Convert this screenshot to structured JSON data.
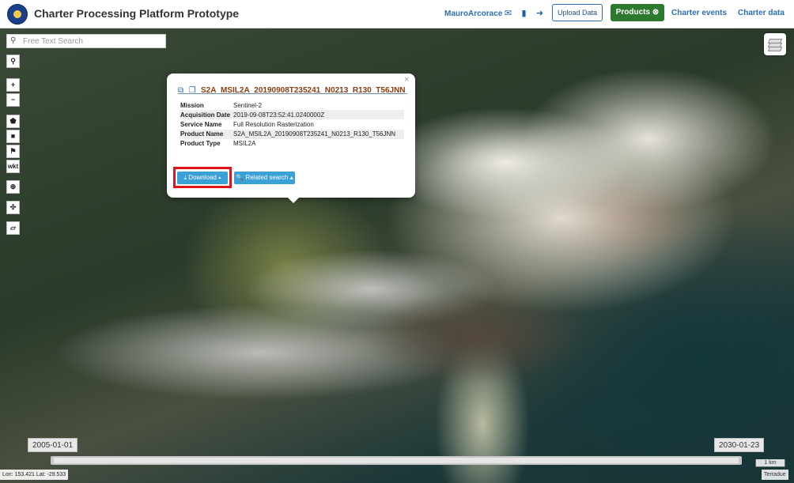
{
  "header": {
    "title": "Charter Processing Platform Prototype",
    "user": "MauroArcorace",
    "upload_label": "Upload Data",
    "products_label": "Products",
    "products_icon": "close-circle-icon",
    "nav": [
      "Charter events",
      "Charter data"
    ],
    "icons": [
      "envelope-icon",
      "book-icon",
      "sign-out-icon"
    ]
  },
  "search": {
    "placeholder": "Free Text Search",
    "value": ""
  },
  "toolbar": {
    "zoom_in": "+",
    "zoom_out": "−",
    "wkt": "wkt",
    "tools": [
      "search-icon",
      "zoom-in-icon",
      "zoom-out-icon",
      "polygon-icon",
      "square-icon",
      "map-marker-icon",
      "wkt-icon",
      "globe-icon",
      "expand-icon",
      "ruler-icon"
    ]
  },
  "popup": {
    "title": "S2A_MSIL2A_20190908T235241_N0213_R130_T56JNN",
    "close": "×",
    "rows": [
      {
        "key": "Mission",
        "value": "Sentinel-2"
      },
      {
        "key": "Acquisition Date",
        "value": "2019-09-08T23:52:41.0240000Z"
      },
      {
        "key": "Service Name",
        "value": "Full Resolution Rasterization"
      },
      {
        "key": "Product Name",
        "value": "S2A_MSIL2A_20190908T235241_N0213_R130_T56JNN"
      },
      {
        "key": "Product Type",
        "value": "MSIL2A"
      }
    ],
    "download_label": "⤓ Download ▴",
    "related_label": "🔍 Related search ▴"
  },
  "timeline": {
    "start": "2005-01-01",
    "end": "2030-01-23"
  },
  "scale": "1 km",
  "coords": "Lon: 153.421 Lat: -29.533",
  "attribution": "Terradue",
  "colors": {
    "accent": "#2a6fb5",
    "products_button": "#2d7a2e",
    "popup_button": "#3aa0d8",
    "highlight": "#e0151c",
    "popup_title": "#8a3d10"
  }
}
